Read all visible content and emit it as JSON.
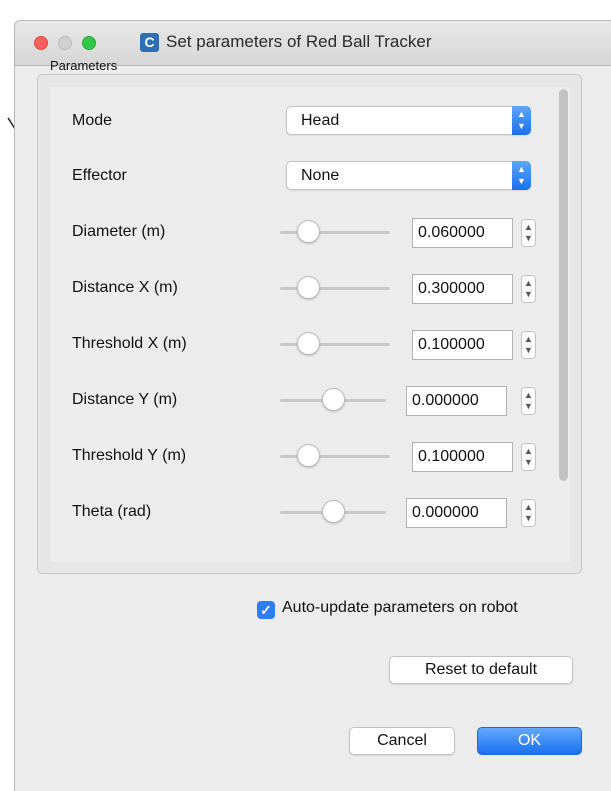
{
  "window": {
    "title": "Set parameters of Red Ball Tracker",
    "app_icon_letter": "C"
  },
  "group": {
    "title": "Parameters"
  },
  "params": {
    "mode": {
      "label": "Mode",
      "value": "Head"
    },
    "effector": {
      "label": "Effector",
      "value": "None"
    },
    "diameter": {
      "label": "Diameter (m)",
      "value": "0.060000",
      "slider_fraction": 0.2
    },
    "distance_x": {
      "label": "Distance X (m)",
      "value": "0.300000",
      "slider_fraction": 0.2
    },
    "threshold_x": {
      "label": "Threshold X (m)",
      "value": "0.100000",
      "slider_fraction": 0.2
    },
    "distance_y": {
      "label": "Distance Y (m)",
      "value": "0.000000",
      "slider_fraction": 0.5
    },
    "threshold_y": {
      "label": "Threshold Y (m)",
      "value": "0.100000",
      "slider_fraction": 0.2
    },
    "theta": {
      "label": "Theta (rad)",
      "value": "0.000000",
      "slider_fraction": 0.5
    }
  },
  "auto_update": {
    "label": "Auto-update parameters on robot",
    "checked": true
  },
  "buttons": {
    "reset": "Reset to default",
    "cancel": "Cancel",
    "ok": "OK"
  },
  "icons": {
    "select_arrows": "chevron-up-down-icon",
    "spin_arrows": "stepper-arrows-icon",
    "check": "checkmark-icon"
  },
  "colors": {
    "accent": "#1a70f2",
    "close": "#fc605c",
    "maximize": "#34c84a"
  }
}
